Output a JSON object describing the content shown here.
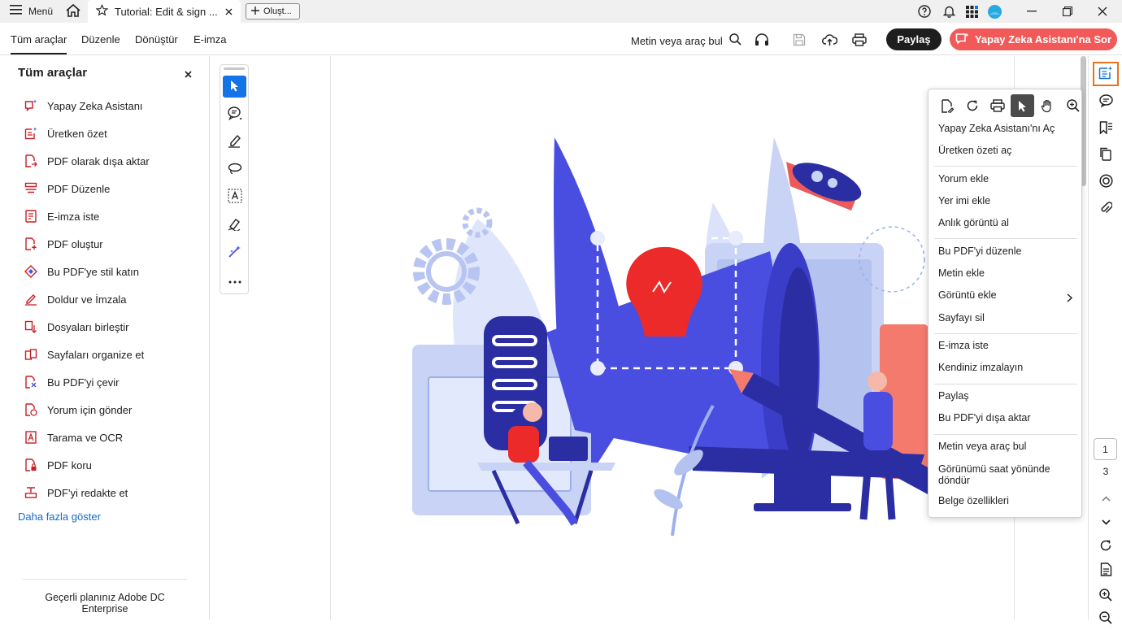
{
  "titlebar": {
    "menu_label": "Menü",
    "tab_title": "Tutorial: Edit & sign ...",
    "create_label": "Oluşt..."
  },
  "menubar": {
    "items": [
      "Tüm araçlar",
      "Düzenle",
      "Dönüştür",
      "E-imza"
    ],
    "search_label": "Metin veya araç bul",
    "share_label": "Paylaş",
    "ai_label": "Yapay Zeka Asistanı'na Sor"
  },
  "left_panel": {
    "title": "Tüm araçlar",
    "tools": [
      {
        "label": "Yapay Zeka Asistanı",
        "icon": "ai-assistant-icon"
      },
      {
        "label": "Üretken özet",
        "icon": "generative-summary-icon"
      },
      {
        "label": "PDF olarak dışa aktar",
        "icon": "export-pdf-icon"
      },
      {
        "label": "PDF Düzenle",
        "icon": "edit-pdf-icon"
      },
      {
        "label": "E-imza iste",
        "icon": "request-esign-icon"
      },
      {
        "label": "PDF oluştur",
        "icon": "create-pdf-icon"
      },
      {
        "label": "Bu PDF'ye stil katın",
        "icon": "style-pdf-icon"
      },
      {
        "label": "Doldur ve İmzala",
        "icon": "fill-sign-icon"
      },
      {
        "label": "Dosyaları birleştir",
        "icon": "combine-files-icon"
      },
      {
        "label": "Sayfaları organize et",
        "icon": "organize-pages-icon"
      },
      {
        "label": "Bu PDF'yi çevir",
        "icon": "translate-pdf-icon"
      },
      {
        "label": "Yorum için gönder",
        "icon": "send-comment-icon"
      },
      {
        "label": "Tarama ve OCR",
        "icon": "scan-ocr-icon"
      },
      {
        "label": "PDF koru",
        "icon": "protect-pdf-icon"
      },
      {
        "label": "PDF'yi redakte et",
        "icon": "redact-pdf-icon"
      }
    ],
    "more_label": "Daha fazla göster",
    "plan_text": "Geçerli planınız Adobe DC Enterprise"
  },
  "context_menu": {
    "items": [
      "Yapay Zeka Asistanı'nı Aç",
      "Üretken özeti aç",
      "Yorum ekle",
      "Yer imi ekle",
      "Anlık görüntü al",
      "Bu PDF'yi düzenle",
      "Metin ekle",
      "Görüntü ekle",
      "Sayfayı sil",
      "E-imza iste",
      "Kendiniz imzalayın",
      "Paylaş",
      "Bu PDF'yi dışa aktar",
      "Metin veya araç bul",
      "Görünümü saat yönünde döndür",
      "Belge özellikleri"
    ]
  },
  "page_nav": {
    "current_page": "1",
    "total_pages": "3"
  },
  "colors": {
    "accent_blue": "#1473e6",
    "ai_red": "#f25a5a",
    "highlight_orange": "#e8731a",
    "illustration_blue": "#4a4ee0"
  }
}
